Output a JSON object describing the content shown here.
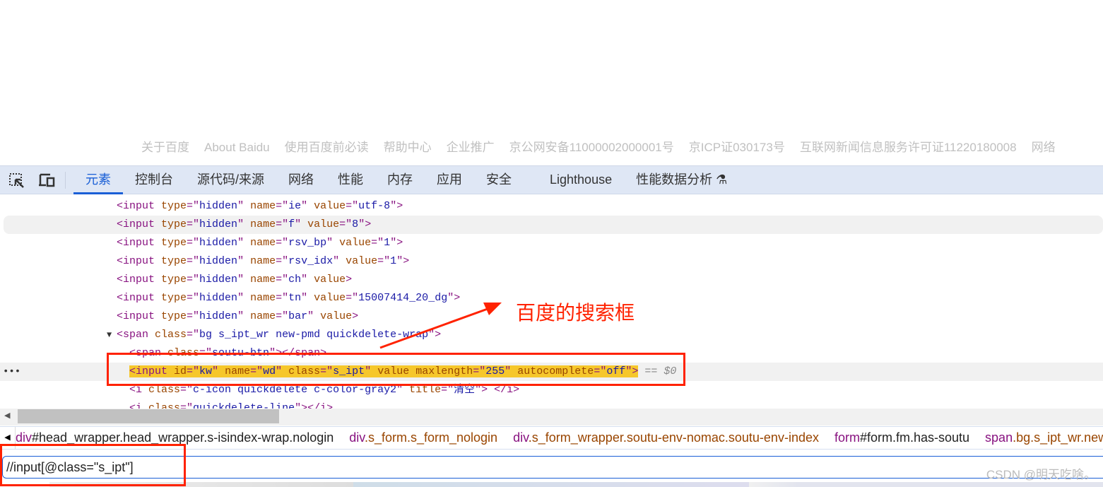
{
  "footer_links": [
    "关于百度",
    "About Baidu",
    "使用百度前必读",
    "帮助中心",
    "企业推广",
    "京公网安备11000002000001号",
    "京ICP证030173号",
    "互联网新闻信息服务许可证11220180008",
    "网络"
  ],
  "devtools": {
    "tabs": [
      "元素",
      "控制台",
      "源代码/来源",
      "网络",
      "性能",
      "内存",
      "应用",
      "安全",
      "Lighthouse",
      "性能数据分析 ⚗"
    ],
    "active_tab": "元素",
    "accent": "#1a5fd6"
  },
  "code_lines": [
    {
      "indent": 0,
      "tokens": [
        [
          "tg",
          "<input "
        ],
        [
          "an",
          "type"
        ],
        [
          "tg",
          "=\""
        ],
        [
          "av",
          "hidden"
        ],
        [
          "tg",
          "\" "
        ],
        [
          "an",
          "name"
        ],
        [
          "tg",
          "=\""
        ],
        [
          "av",
          "ie"
        ],
        [
          "tg",
          "\" "
        ],
        [
          "an",
          "value"
        ],
        [
          "tg",
          "=\""
        ],
        [
          "av",
          "utf-8"
        ],
        [
          "tg",
          "\">"
        ]
      ]
    },
    {
      "indent": 0,
      "hover": true,
      "tokens": [
        [
          "tg",
          "<input "
        ],
        [
          "an",
          "type"
        ],
        [
          "tg",
          "=\""
        ],
        [
          "av",
          "hidden"
        ],
        [
          "tg",
          "\" "
        ],
        [
          "an",
          "name"
        ],
        [
          "tg",
          "=\""
        ],
        [
          "av",
          "f"
        ],
        [
          "tg",
          "\" "
        ],
        [
          "an",
          "value"
        ],
        [
          "tg",
          "=\""
        ],
        [
          "av",
          "8"
        ],
        [
          "tg",
          "\">"
        ]
      ]
    },
    {
      "indent": 0,
      "tokens": [
        [
          "tg",
          "<input "
        ],
        [
          "an",
          "type"
        ],
        [
          "tg",
          "=\""
        ],
        [
          "av",
          "hidden"
        ],
        [
          "tg",
          "\" "
        ],
        [
          "an",
          "name"
        ],
        [
          "tg",
          "=\""
        ],
        [
          "av",
          "rsv_bp"
        ],
        [
          "tg",
          "\" "
        ],
        [
          "an",
          "value"
        ],
        [
          "tg",
          "=\""
        ],
        [
          "av",
          "1"
        ],
        [
          "tg",
          "\">"
        ]
      ]
    },
    {
      "indent": 0,
      "tokens": [
        [
          "tg",
          "<input "
        ],
        [
          "an",
          "type"
        ],
        [
          "tg",
          "=\""
        ],
        [
          "av",
          "hidden"
        ],
        [
          "tg",
          "\" "
        ],
        [
          "an",
          "name"
        ],
        [
          "tg",
          "=\""
        ],
        [
          "av",
          "rsv_idx"
        ],
        [
          "tg",
          "\" "
        ],
        [
          "an",
          "value"
        ],
        [
          "tg",
          "=\""
        ],
        [
          "av",
          "1"
        ],
        [
          "tg",
          "\">"
        ]
      ]
    },
    {
      "indent": 0,
      "tokens": [
        [
          "tg",
          "<input "
        ],
        [
          "an",
          "type"
        ],
        [
          "tg",
          "=\""
        ],
        [
          "av",
          "hidden"
        ],
        [
          "tg",
          "\" "
        ],
        [
          "an",
          "name"
        ],
        [
          "tg",
          "=\""
        ],
        [
          "av",
          "ch"
        ],
        [
          "tg",
          "\" "
        ],
        [
          "an",
          "value"
        ],
        [
          "tg",
          ">"
        ]
      ]
    },
    {
      "indent": 0,
      "tokens": [
        [
          "tg",
          "<input "
        ],
        [
          "an",
          "type"
        ],
        [
          "tg",
          "=\""
        ],
        [
          "av",
          "hidden"
        ],
        [
          "tg",
          "\" "
        ],
        [
          "an",
          "name"
        ],
        [
          "tg",
          "=\""
        ],
        [
          "av",
          "tn"
        ],
        [
          "tg",
          "\" "
        ],
        [
          "an",
          "value"
        ],
        [
          "tg",
          "=\""
        ],
        [
          "av",
          "15007414_20_dg"
        ],
        [
          "tg",
          "\">"
        ]
      ]
    },
    {
      "indent": 0,
      "tokens": [
        [
          "tg",
          "<input "
        ],
        [
          "an",
          "type"
        ],
        [
          "tg",
          "=\""
        ],
        [
          "av",
          "hidden"
        ],
        [
          "tg",
          "\" "
        ],
        [
          "an",
          "name"
        ],
        [
          "tg",
          "=\""
        ],
        [
          "av",
          "bar"
        ],
        [
          "tg",
          "\" "
        ],
        [
          "an",
          "value"
        ],
        [
          "tg",
          ">"
        ]
      ]
    },
    {
      "indent": 0,
      "expander": "▼",
      "tokens": [
        [
          "tg",
          "<span "
        ],
        [
          "an",
          "class"
        ],
        [
          "tg",
          "=\""
        ],
        [
          "av",
          "bg s_ipt_wr new-pmd quickdelete-wrap"
        ],
        [
          "tg",
          "\">"
        ]
      ]
    },
    {
      "indent": 1,
      "tokens": [
        [
          "tg",
          "<span "
        ],
        [
          "an",
          "class"
        ],
        [
          "tg",
          "=\""
        ],
        [
          "av",
          "soutu-btn"
        ],
        [
          "tg",
          "\"></span>"
        ]
      ]
    },
    {
      "indent": 1,
      "selected": true,
      "tokens": [
        [
          "tg",
          "<input "
        ],
        [
          "an",
          "id"
        ],
        [
          "tg",
          "=\""
        ],
        [
          "av",
          "kw"
        ],
        [
          "tg",
          "\" "
        ],
        [
          "an",
          "name"
        ],
        [
          "tg",
          "=\""
        ],
        [
          "av",
          "wd"
        ],
        [
          "tg",
          "\" "
        ],
        [
          "an",
          "class"
        ],
        [
          "tg",
          "=\""
        ],
        [
          "av",
          "s_ipt"
        ],
        [
          "tg",
          "\" "
        ],
        [
          "an",
          "value maxlength"
        ],
        [
          "tg",
          "=\""
        ],
        [
          "av",
          "255"
        ],
        [
          "tg",
          "\" "
        ],
        [
          "an",
          "autocomplete"
        ],
        [
          "tg",
          "=\""
        ],
        [
          "av",
          "off"
        ],
        [
          "tg",
          "\">"
        ]
      ],
      "suffix": " == $0"
    },
    {
      "indent": 1,
      "tokens": [
        [
          "tg",
          "<i "
        ],
        [
          "an",
          "class"
        ],
        [
          "tg",
          "=\""
        ],
        [
          "av",
          "c-icon quickdelete c-color-gray2"
        ],
        [
          "tg",
          "\" "
        ],
        [
          "an",
          "title"
        ],
        [
          "tg",
          "=\""
        ],
        [
          "av",
          "清空"
        ],
        [
          "tg",
          "\"> </i>"
        ]
      ]
    },
    {
      "indent": 1,
      "tokens": [
        [
          "tg",
          "<i "
        ],
        [
          "an",
          "class"
        ],
        [
          "tg",
          "=\""
        ],
        [
          "av",
          "quickdelete-line"
        ],
        [
          "tg",
          "\"></i>"
        ]
      ]
    }
  ],
  "breadcrumbs": [
    [
      "div",
      "#head_wrapper.head_wrapper.s-isindex-wrap.nologin"
    ],
    [
      "div",
      ".s_form.s_form_nologin"
    ],
    [
      "div",
      ".s_form_wrapper.soutu-env-nomac.soutu-env-index"
    ],
    [
      "form",
      "#form.fm.has-soutu"
    ],
    [
      "span",
      ".bg.s_ipt_wr.new-pmd.quickdelete-wrap"
    ]
  ],
  "search": {
    "xpath_value": "//input[@class=\"s_ipt\"]"
  },
  "annotation": {
    "text": "百度的搜索框",
    "color": "#ff2200"
  },
  "watermark": "CSDN @明天吃啥。"
}
